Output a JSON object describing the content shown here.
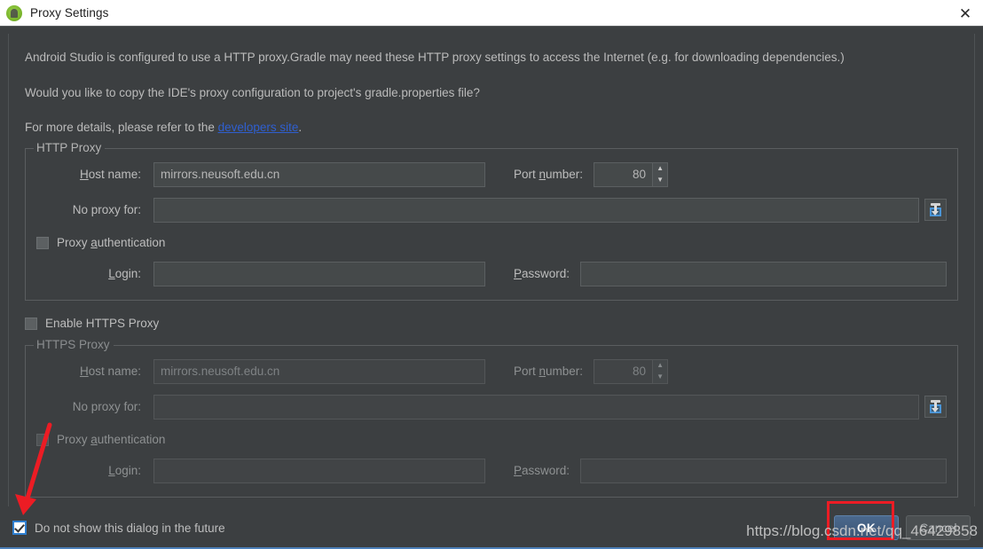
{
  "window": {
    "title": "Proxy Settings",
    "icon": "android-studio-icon",
    "close_label": "✕"
  },
  "description": {
    "line1": "Android Studio is configured to use a HTTP proxy.Gradle may need these HTTP proxy settings to access the Internet (e.g. for downloading dependencies.)",
    "line2": "Would you like to copy the IDE's proxy configuration to project's gradle.properties file?",
    "line3_prefix": "For more details, please refer to the ",
    "line3_link": "developers site",
    "line3_suffix": "."
  },
  "http_proxy": {
    "group_title": "HTTP Proxy",
    "host_label_mnemonic": "H",
    "host_label_rest": "ost name:",
    "host_value": "mirrors.neusoft.edu.cn",
    "port_label_prefix": "Port ",
    "port_label_mnemonic": "n",
    "port_label_rest": "umber:",
    "port_value": "80",
    "spinner_up": "▲",
    "spinner_down": "▼",
    "noproxy_label": "No proxy for:",
    "noproxy_value": "",
    "browse_icon": "import-icon",
    "auth_checkbox_prefix": "Proxy ",
    "auth_checkbox_mnemonic": "a",
    "auth_checkbox_rest": "uthentication",
    "auth_checked": false,
    "login_label_mnemonic": "L",
    "login_label_rest": "ogin:",
    "login_value": "",
    "password_label_mnemonic": "P",
    "password_label_rest": "assword:",
    "password_value": ""
  },
  "enable_https": {
    "label": "Enable HTTPS Proxy",
    "checked": false
  },
  "https_proxy": {
    "group_title": "HTTPS Proxy",
    "host_label_mnemonic": "H",
    "host_label_rest": "ost name:",
    "host_value": "mirrors.neusoft.edu.cn",
    "port_label_prefix": "Port ",
    "port_label_mnemonic": "n",
    "port_label_rest": "umber:",
    "port_value": "80",
    "spinner_up": "▲",
    "spinner_down": "▼",
    "noproxy_label": "No proxy for:",
    "noproxy_value": "",
    "browse_icon": "import-icon",
    "auth_checkbox_prefix": "Proxy ",
    "auth_checkbox_mnemonic": "a",
    "auth_checkbox_rest": "uthentication",
    "auth_checked": false,
    "login_label_mnemonic": "L",
    "login_label_rest": "ogin:",
    "login_value": "",
    "password_label_mnemonic": "P",
    "password_label_rest": "assword:",
    "password_value": ""
  },
  "footer": {
    "do_not_show_label": "Do not show this dialog in the future",
    "do_not_show_checked": true,
    "ok_label": "OK",
    "cancel_label": "Cancel"
  },
  "annotations": {
    "watermark": "https://blog.csdn.net/qq_46429858",
    "accent_red": "#ec1c24",
    "accent_blue": "#2f7fd0",
    "link_blue": "#2f5fd0"
  }
}
